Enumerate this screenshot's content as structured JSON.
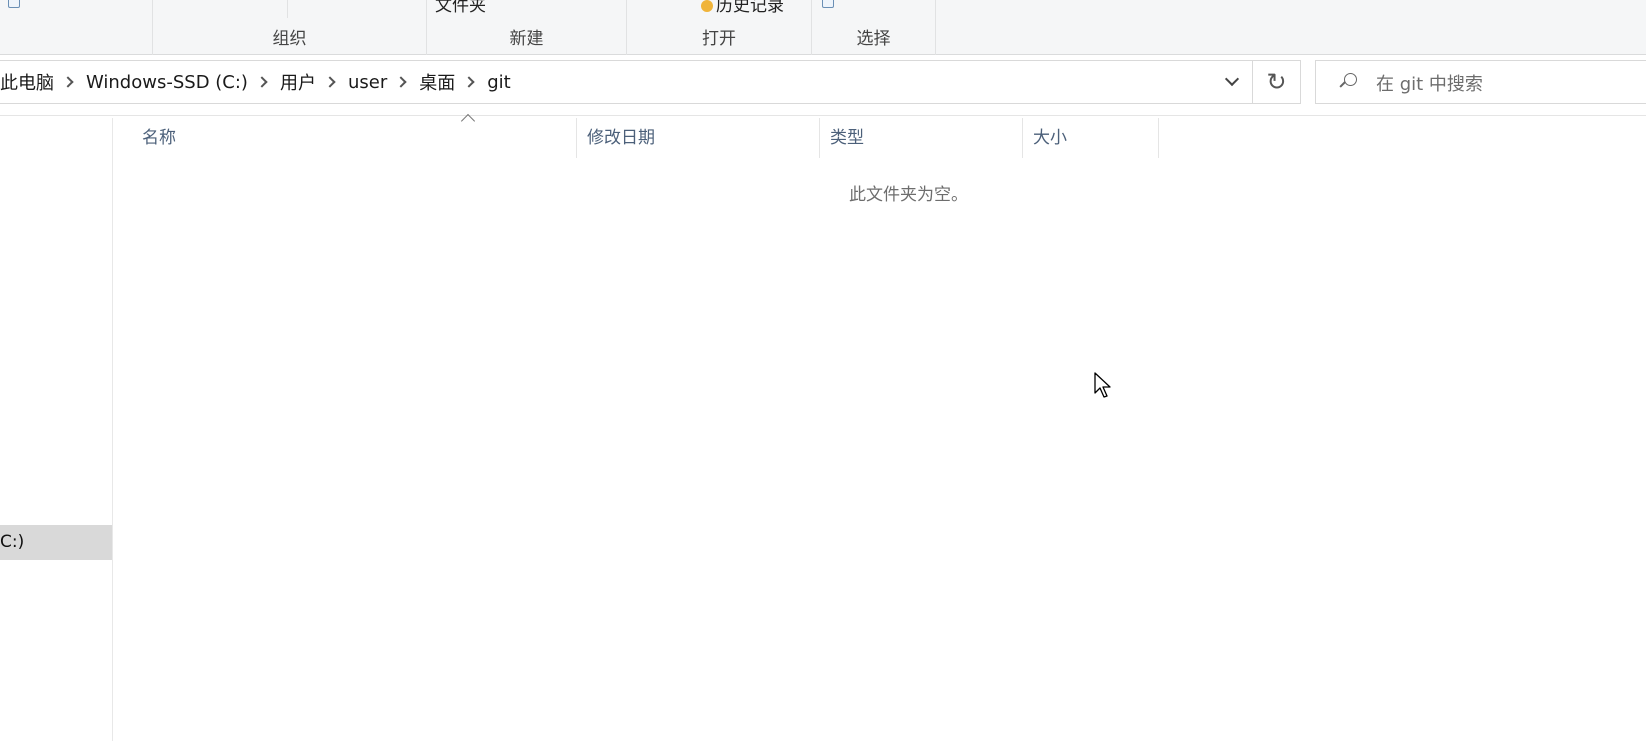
{
  "ribbon": {
    "groups": [
      {
        "label": "组织"
      },
      {
        "label": "新建",
        "partial": "文件夹"
      },
      {
        "label": "打开",
        "partial": "历史记录"
      },
      {
        "label": "选择"
      }
    ]
  },
  "address": {
    "crumbs": [
      "此电脑",
      "Windows-SSD (C:)",
      "用户",
      "user",
      "桌面",
      "git"
    ],
    "refresh_glyph": "↻"
  },
  "search": {
    "placeholder": "在 git 中搜索"
  },
  "nav": {
    "selected_item": "C:)"
  },
  "columns": {
    "name": "名称",
    "date": "修改日期",
    "type": "类型",
    "size": "大小"
  },
  "content": {
    "empty_message": "此文件夹为空。"
  },
  "colors": {
    "ribbon_bg": "#f5f6f7",
    "header_text": "#4c607a",
    "selected_bg": "#d9d9d9"
  },
  "icons": [
    "chevron-right-icon",
    "chevron-down-icon",
    "refresh-icon",
    "search-icon",
    "sort-up-icon",
    "cursor-icon",
    "history-icon",
    "select-icon"
  ]
}
